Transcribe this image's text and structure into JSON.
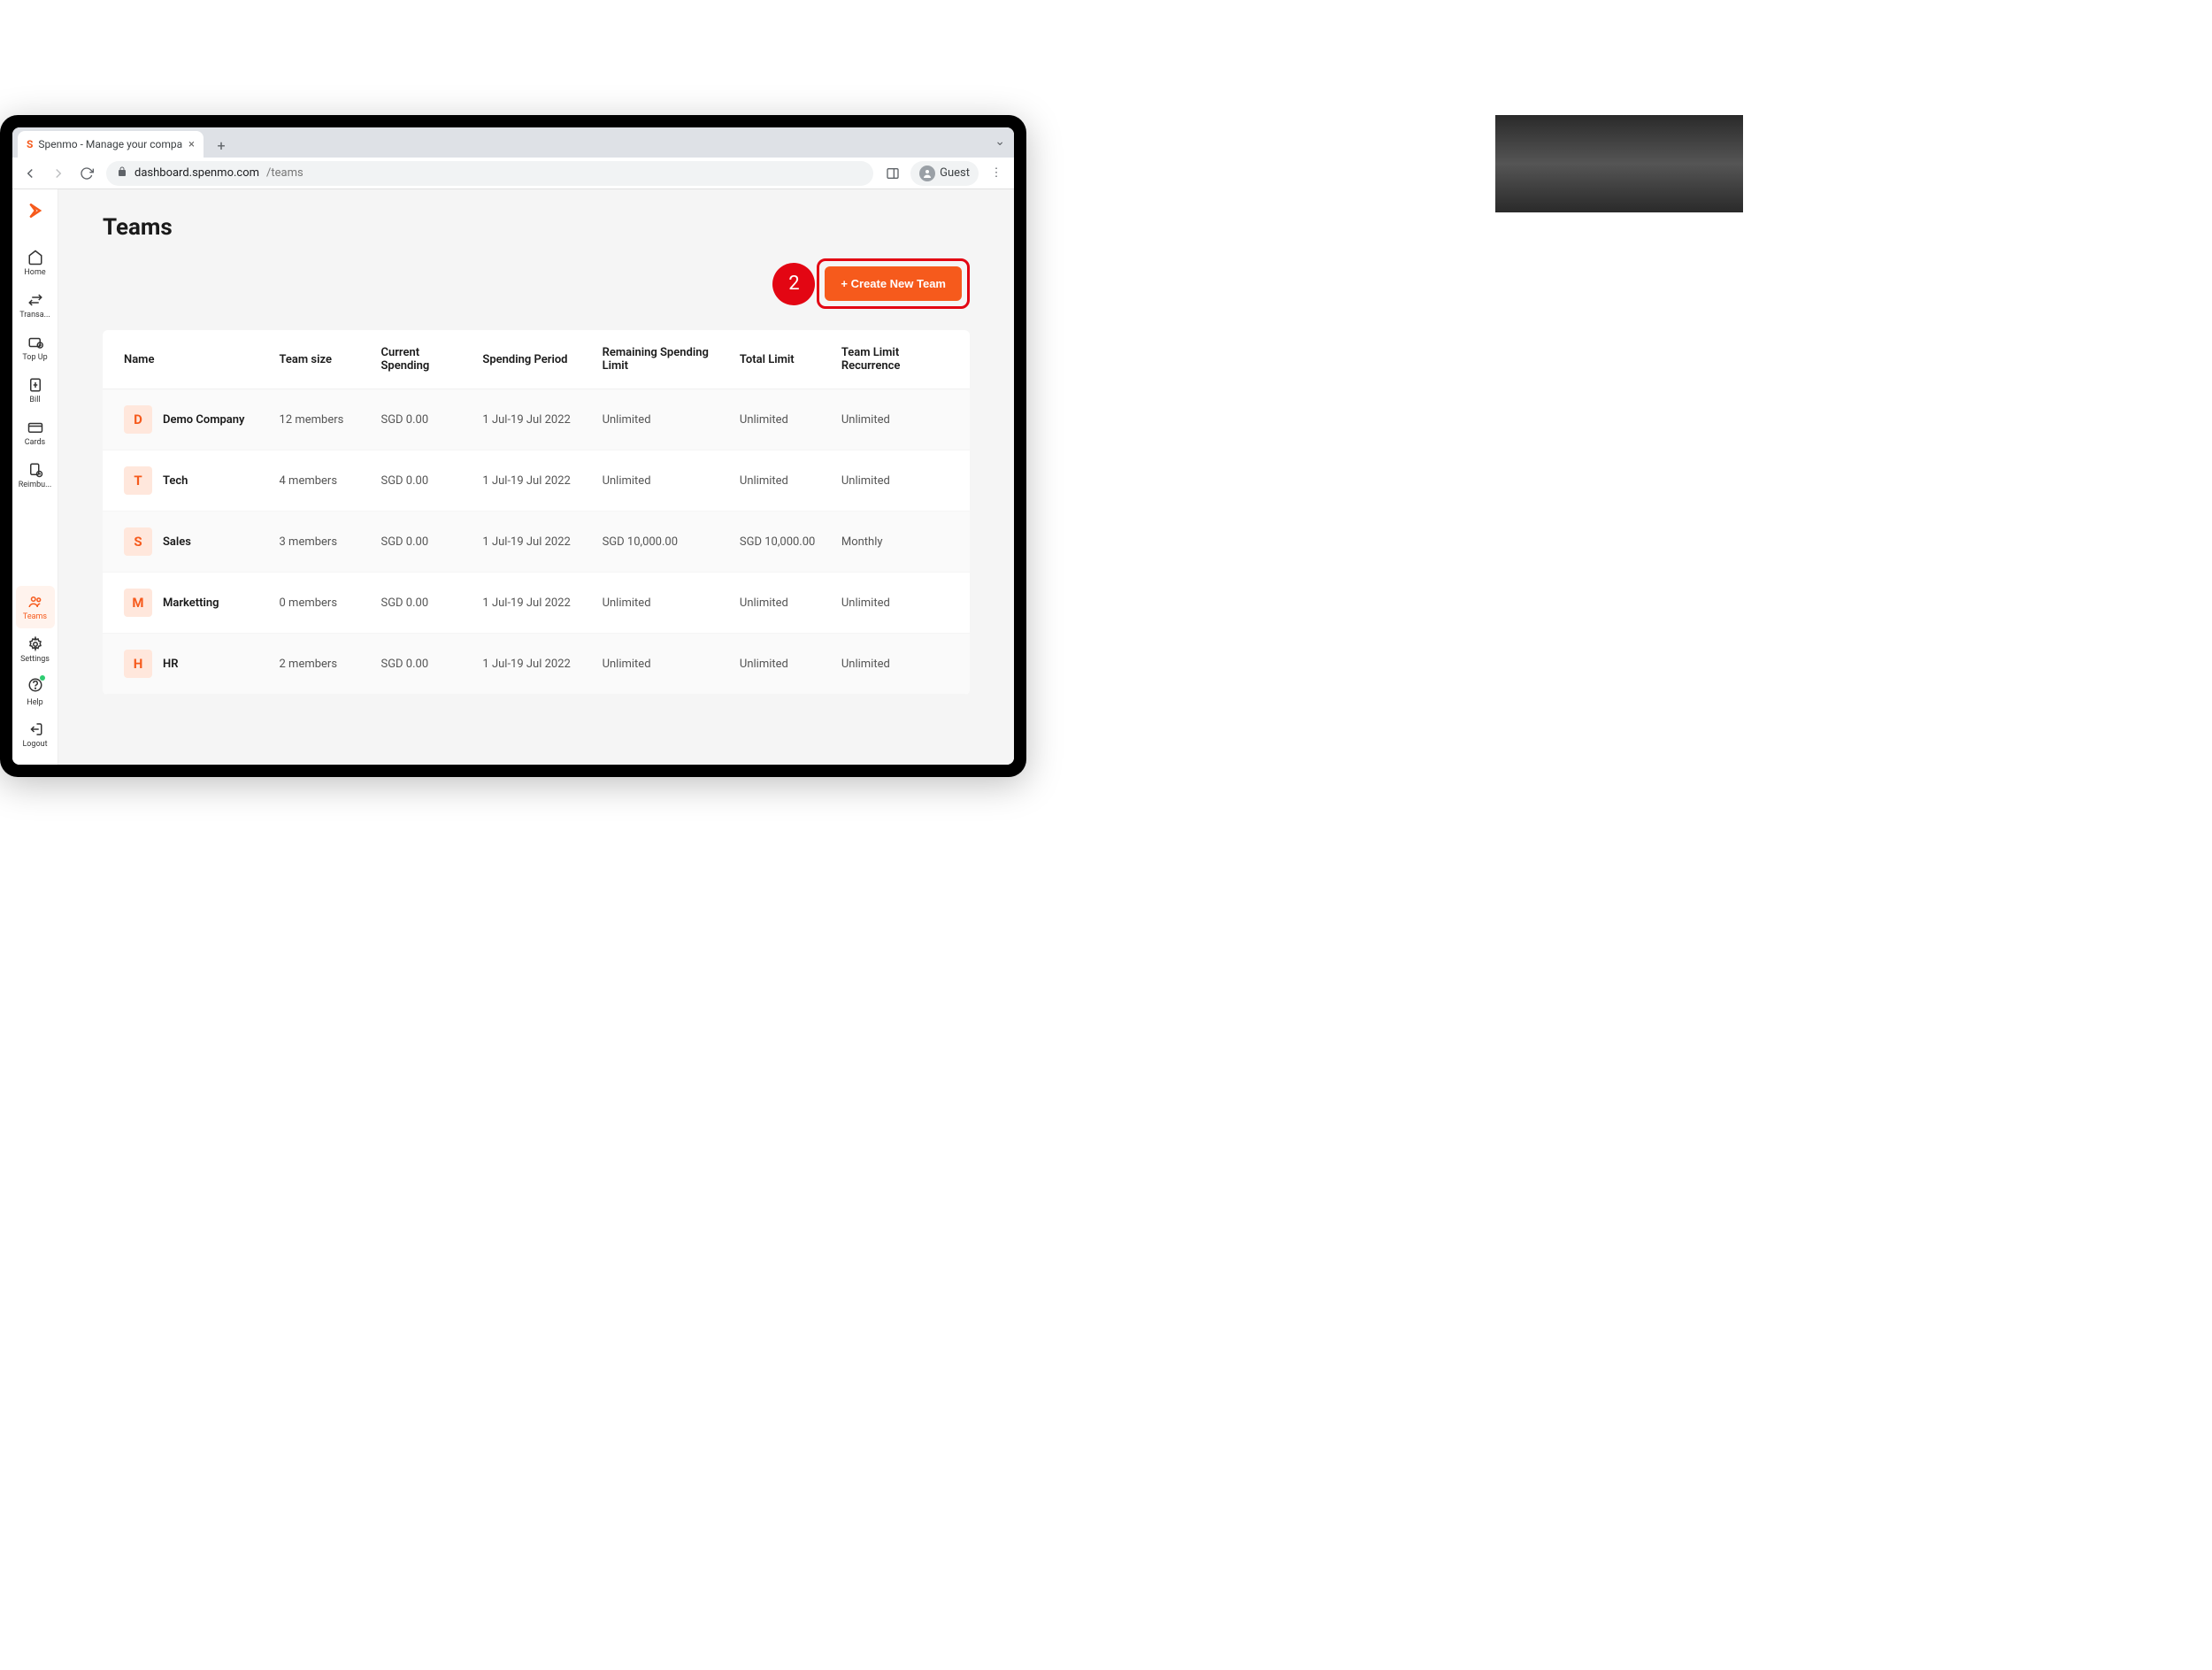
{
  "browser": {
    "tab_title": "Spenmo - Manage your compa",
    "url_domain": "dashboard.spenmo.com",
    "url_path": "/teams",
    "guest_label": "Guest"
  },
  "sidebar": {
    "items": [
      {
        "label": "Home"
      },
      {
        "label": "Transa..."
      },
      {
        "label": "Top Up"
      },
      {
        "label": "Bill"
      },
      {
        "label": "Cards"
      },
      {
        "label": "Reimbu..."
      }
    ],
    "bottom": [
      {
        "label": "Teams",
        "active": true
      },
      {
        "label": "Settings"
      },
      {
        "label": "Help"
      },
      {
        "label": "Logout"
      }
    ]
  },
  "page": {
    "title": "Teams",
    "step_badge": "2",
    "create_label": "+ Create New Team",
    "columns": [
      "Name",
      "Team size",
      "Current Spending",
      "Spending Period",
      "Remaining Spending Limit",
      "Total Limit",
      "Team Limit Recurrence"
    ],
    "rows": [
      {
        "initial": "D",
        "name": "Demo Company",
        "size": "12 members",
        "spending": "SGD 0.00",
        "period": "1 Jul-19 Jul 2022",
        "remaining": "Unlimited",
        "total": "Unlimited",
        "recurrence": "Unlimited"
      },
      {
        "initial": "T",
        "name": "Tech",
        "size": "4 members",
        "spending": "SGD 0.00",
        "period": "1 Jul-19 Jul 2022",
        "remaining": "Unlimited",
        "total": "Unlimited",
        "recurrence": "Unlimited"
      },
      {
        "initial": "S",
        "name": "Sales",
        "size": "3 members",
        "spending": "SGD 0.00",
        "period": "1 Jul-19 Jul 2022",
        "remaining": "SGD 10,000.00",
        "total": "SGD 10,000.00",
        "recurrence": "Monthly"
      },
      {
        "initial": "M",
        "name": "Marketting",
        "size": "0 members",
        "spending": "SGD 0.00",
        "period": "1 Jul-19 Jul 2022",
        "remaining": "Unlimited",
        "total": "Unlimited",
        "recurrence": "Unlimited"
      },
      {
        "initial": "H",
        "name": "HR",
        "size": "2 members",
        "spending": "SGD 0.00",
        "period": "1 Jul-19 Jul 2022",
        "remaining": "Unlimited",
        "total": "Unlimited",
        "recurrence": "Unlimited"
      }
    ]
  }
}
